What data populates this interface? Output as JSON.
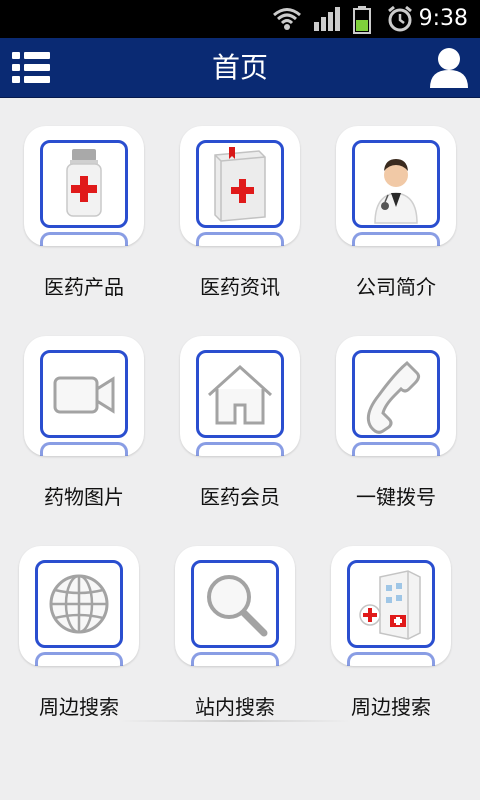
{
  "status_bar": {
    "time": "9:38",
    "icons": [
      "wifi-icon",
      "signal-icon",
      "battery-icon",
      "alarm-icon"
    ]
  },
  "header": {
    "title": "首页",
    "menu_icon": "list-menu-icon",
    "user_icon": "user-icon",
    "background": "#0a2a73"
  },
  "grid": {
    "accent": "#2a4ecf",
    "items": [
      {
        "label": "医药产品",
        "icon": "medicine-bottle-icon"
      },
      {
        "label": "医药资讯",
        "icon": "medical-book-icon"
      },
      {
        "label": "公司简介",
        "icon": "doctor-icon"
      },
      {
        "label": "药物图片",
        "icon": "video-camera-icon"
      },
      {
        "label": "医药会员",
        "icon": "home-icon"
      },
      {
        "label": "一键拨号",
        "icon": "phone-icon"
      },
      {
        "label": "周边搜索",
        "icon": "globe-icon"
      },
      {
        "label": "站内搜索",
        "icon": "search-icon"
      },
      {
        "label": "周边搜索",
        "icon": "hospital-icon"
      }
    ]
  }
}
